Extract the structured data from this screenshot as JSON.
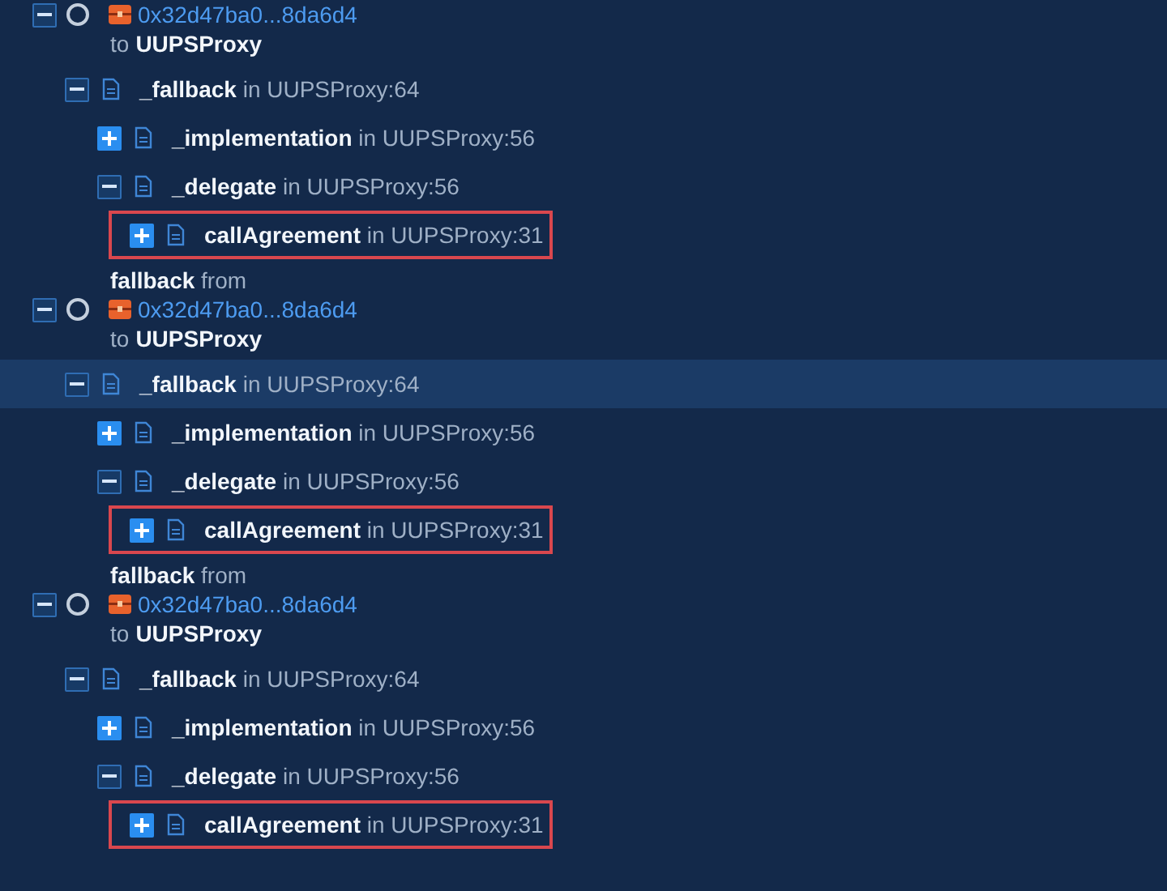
{
  "calls": [
    {
      "expanded": true,
      "address": "0x32d47ba0...8da6d4",
      "to_prefix": "to",
      "to_name": "UUPSProxy",
      "frames": [
        {
          "text": "**_fallback** in UUPSProxy:64",
          "expanded": true,
          "selected": false,
          "highlighted": false,
          "children": [
            {
              "text": "**_implementation** in UUPSProxy:56",
              "expanded": false,
              "selected": false,
              "highlighted": false
            },
            {
              "text": "**_delegate** in UUPSProxy:56",
              "expanded": true,
              "selected": false,
              "highlighted": false,
              "children": [
                {
                  "text": "**callAgreement** in UUPSProxy:31",
                  "expanded": false,
                  "selected": false,
                  "highlighted": true
                }
              ]
            }
          ]
        }
      ]
    },
    {
      "from_label": "**fallback** from",
      "expanded": true,
      "address": "0x32d47ba0...8da6d4",
      "to_prefix": "to",
      "to_name": "UUPSProxy",
      "frames": [
        {
          "text": "**_fallback** in UUPSProxy:64",
          "expanded": true,
          "selected": true,
          "highlighted": false,
          "children": [
            {
              "text": "**_implementation** in UUPSProxy:56",
              "expanded": false,
              "selected": false,
              "highlighted": false
            },
            {
              "text": "**_delegate** in UUPSProxy:56",
              "expanded": true,
              "selected": false,
              "highlighted": false,
              "children": [
                {
                  "text": "**callAgreement** in UUPSProxy:31",
                  "expanded": false,
                  "selected": false,
                  "highlighted": true
                }
              ]
            }
          ]
        }
      ]
    },
    {
      "from_label": "**fallback** from",
      "expanded": true,
      "address": "0x32d47ba0...8da6d4",
      "to_prefix": "to",
      "to_name": "UUPSProxy",
      "frames": [
        {
          "text": "**_fallback** in UUPSProxy:64",
          "expanded": true,
          "selected": false,
          "highlighted": false,
          "children": [
            {
              "text": "**_implementation** in UUPSProxy:56",
              "expanded": false,
              "selected": false,
              "highlighted": false
            },
            {
              "text": "**_delegate** in UUPSProxy:56",
              "expanded": true,
              "selected": false,
              "highlighted": false,
              "children": [
                {
                  "text": "**callAgreement** in UUPSProxy:31",
                  "expanded": false,
                  "selected": false,
                  "highlighted": true
                }
              ]
            }
          ]
        }
      ]
    }
  ]
}
